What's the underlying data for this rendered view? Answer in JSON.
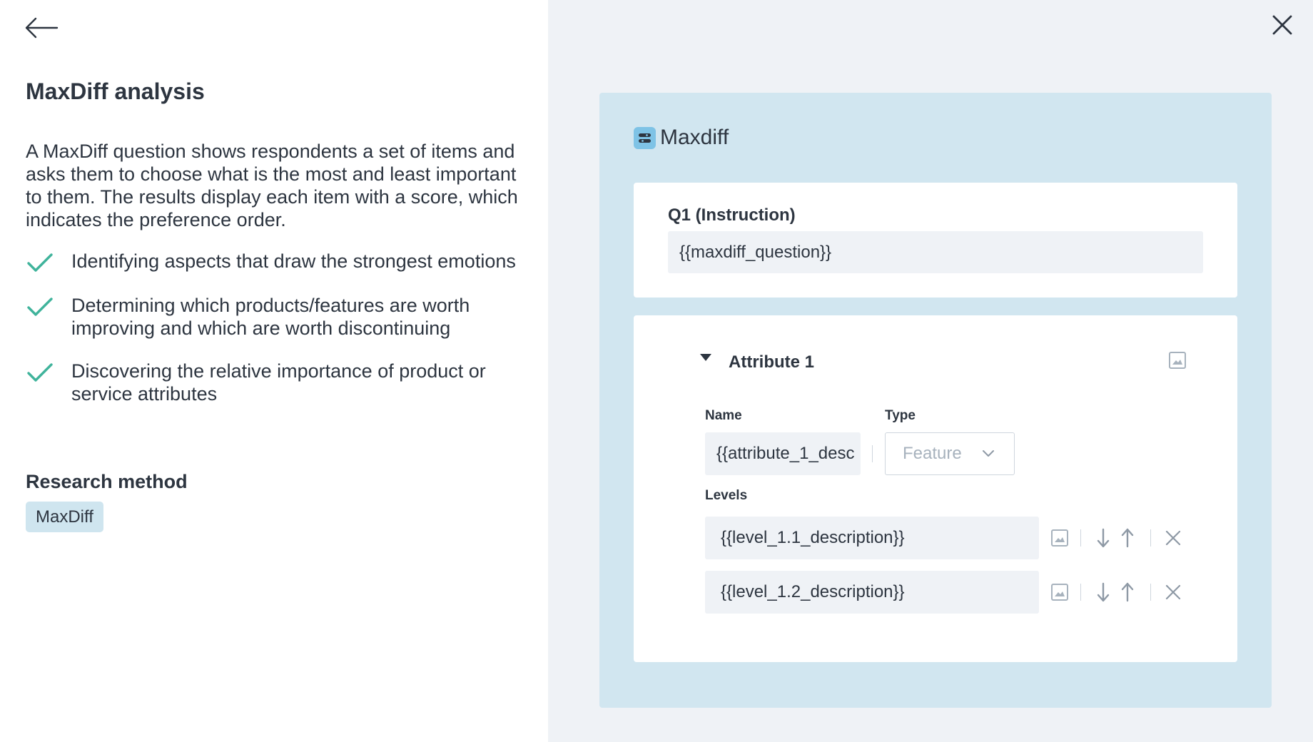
{
  "left": {
    "title": "MaxDiff analysis",
    "description": "A MaxDiff question shows respondents a set of items and asks them to choose what is the most and least important to them. The results display each item with a score, which indicates the preference order.",
    "benefits": [
      "Identifying aspects that draw the strongest emotions",
      "Determining which products/features are worth improving and which are worth discontinuing",
      "Discovering the relative importance of product or service attributes"
    ],
    "research_method_title": "Research method",
    "research_method_value": "MaxDiff"
  },
  "preview": {
    "title": "Maxdiff",
    "question_label": "Q1 (Instruction)",
    "question_value": "{{maxdiff_question}}",
    "attribute": {
      "title": "Attribute 1",
      "name_label": "Name",
      "name_value": "{{attribute_1_desc",
      "type_label": "Type",
      "type_value": "Feature",
      "levels_label": "Levels",
      "levels": [
        "{{level_1.1_description}}",
        "{{level_1.2_description}}"
      ]
    }
  },
  "colors": {
    "accent_check": "#3fb39b",
    "preview_bg": "#d1e6f0",
    "chip_bg": "#cfe5ef",
    "page_bg_right": "#eff2f6"
  },
  "icons": {
    "back": "arrow-left-icon",
    "close": "close-icon",
    "check": "check-icon",
    "badge": "maxdiff-badge-icon",
    "toggle": "caret-down-icon",
    "image": "image-icon",
    "chevron": "chevron-down-icon",
    "down": "arrow-down-icon",
    "up": "arrow-up-icon",
    "remove": "remove-icon"
  }
}
